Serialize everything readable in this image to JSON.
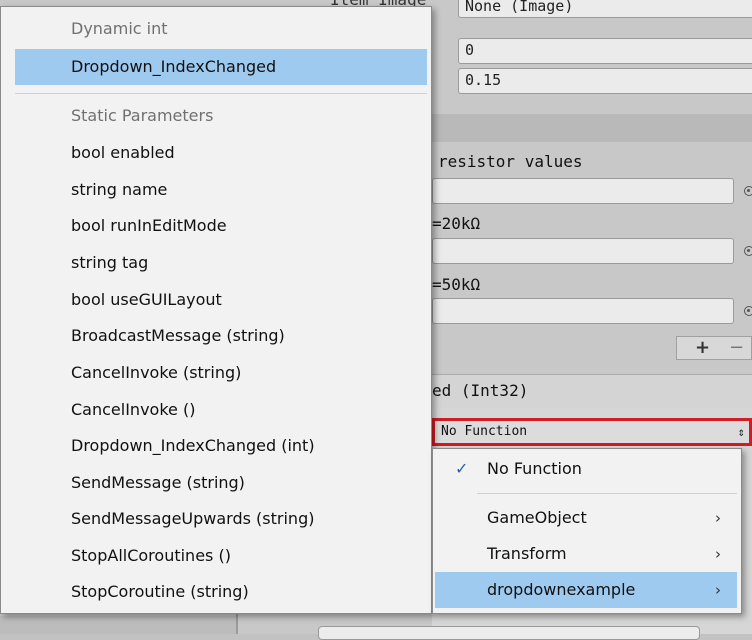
{
  "inspector": {
    "item_image_label": "Item Image",
    "item_image_value": "None (Image)",
    "value_field": "0",
    "alpha_field": "0.15",
    "resistor_text": "resistor values",
    "option_20k": "=20kΩ",
    "option_50k": "=50kΩ",
    "add_label": "+",
    "remove_label": "−",
    "event_label": "ed (Int32)",
    "function_dropdown_value": "No Function",
    "function_dropdown_arrow": "⇕"
  },
  "param_menu": {
    "header_dynamic": "Dynamic int",
    "dynamic_items": [
      "Dropdown_IndexChanged"
    ],
    "header_static": "Static Parameters",
    "static_items": [
      "bool enabled",
      "string name",
      "bool runInEditMode",
      "string tag",
      "bool useGUILayout",
      "BroadcastMessage (string)",
      "CancelInvoke (string)",
      "CancelInvoke ()",
      "Dropdown_IndexChanged (int)",
      "SendMessage (string)",
      "SendMessageUpwards (string)",
      "StopAllCoroutines ()",
      "StopCoroutine (string)"
    ]
  },
  "function_menu": {
    "items": [
      {
        "label": "No Function",
        "checked": true,
        "submenu": false
      },
      {
        "label": "GameObject",
        "checked": false,
        "submenu": true
      },
      {
        "label": "Transform",
        "checked": false,
        "submenu": true
      },
      {
        "label": "dropdownexample",
        "checked": false,
        "submenu": true
      }
    ],
    "checkmark_icon": "✓",
    "chevron_icon": "›"
  },
  "colors": {
    "selection": "#9fcaf0",
    "highlight_border": "#d01c24",
    "menu_bg": "#f2f2f2",
    "inspector_bg": "#c8c8c8"
  }
}
